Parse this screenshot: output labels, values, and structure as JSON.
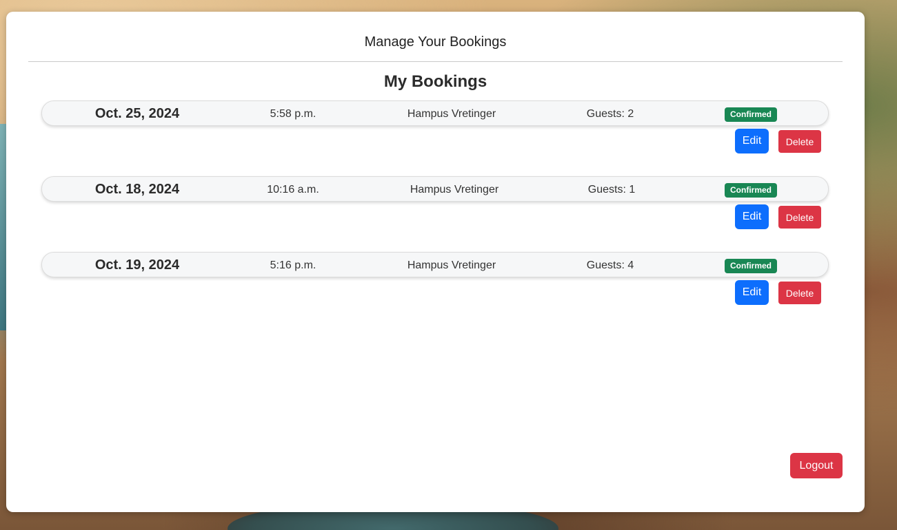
{
  "header": {
    "title": "Manage Your Bookings"
  },
  "section": {
    "title": "My Bookings"
  },
  "bookings": [
    {
      "date": "Oct. 25, 2024",
      "time": "5:58 p.m.",
      "name": "Hampus Vretinger",
      "guests": "Guests: 2",
      "status": "Confirmed",
      "edit_label": "Edit",
      "delete_label": "Delete"
    },
    {
      "date": "Oct. 18, 2024",
      "time": "10:16 a.m.",
      "name": "Hampus Vretinger",
      "guests": "Guests: 1",
      "status": "Confirmed",
      "edit_label": "Edit",
      "delete_label": "Delete"
    },
    {
      "date": "Oct. 19, 2024",
      "time": "5:16 p.m.",
      "name": "Hampus Vretinger",
      "guests": "Guests: 4",
      "status": "Confirmed",
      "edit_label": "Edit",
      "delete_label": "Delete"
    }
  ],
  "logout_label": "Logout",
  "colors": {
    "primary": "#0d6efd",
    "danger": "#dc3545",
    "success": "#198754"
  }
}
